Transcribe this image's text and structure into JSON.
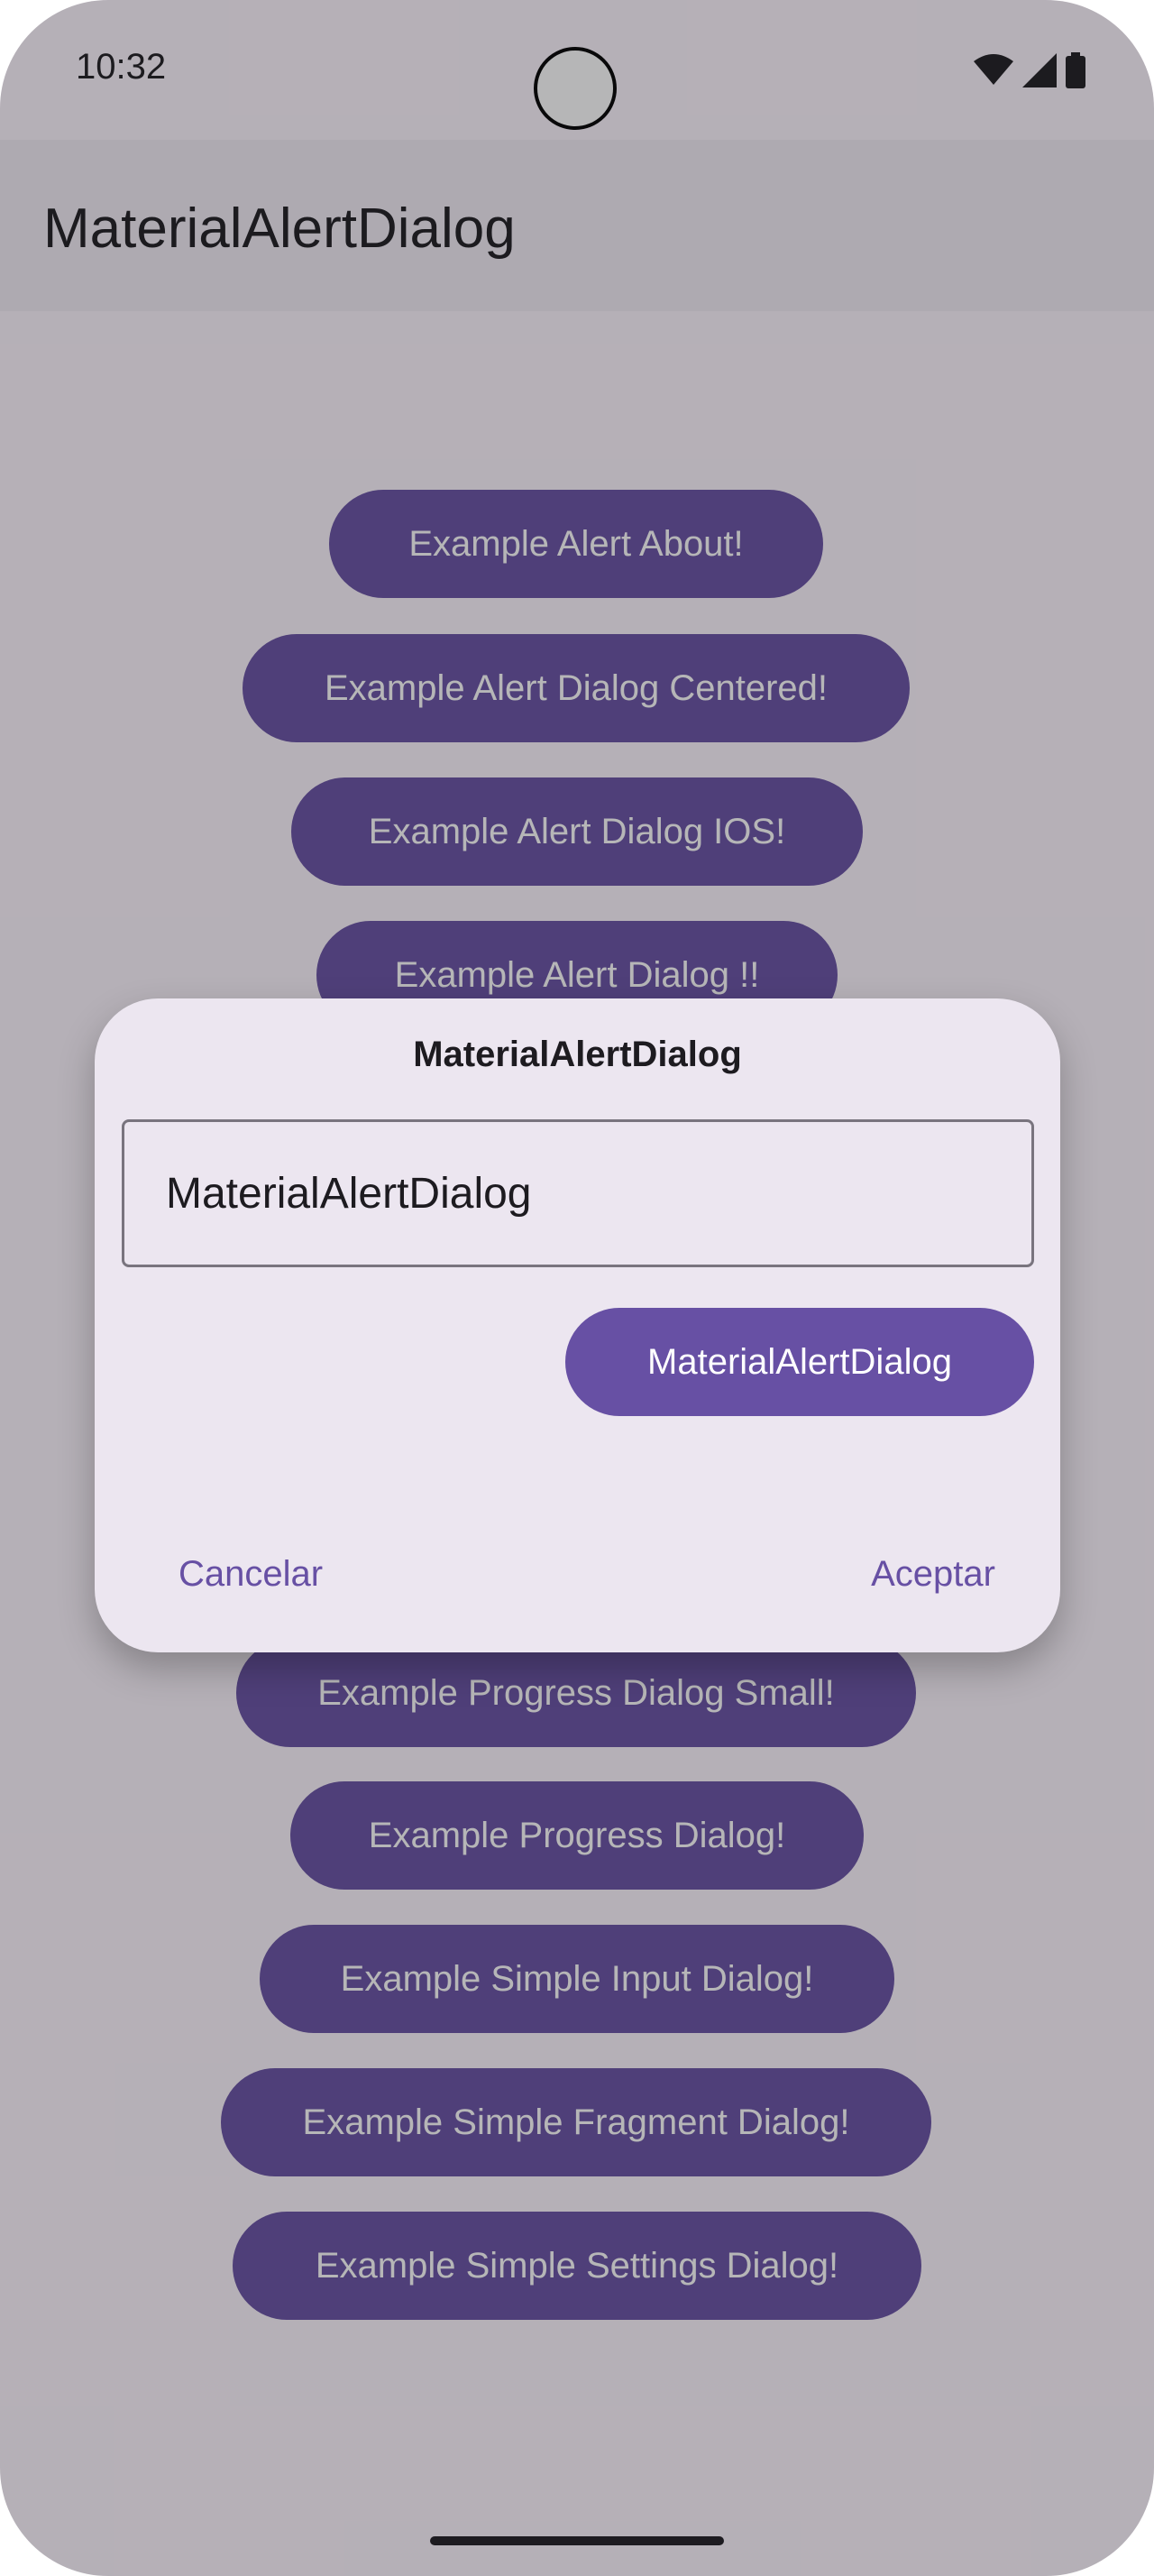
{
  "status_bar": {
    "time": "10:32",
    "icons": [
      "wifi-icon",
      "signal-icon",
      "battery-icon"
    ]
  },
  "app_bar": {
    "title": "MaterialAlertDialog"
  },
  "buttons": [
    "Example Alert About!",
    "Example Alert Dialog Centered!",
    "Example Alert Dialog IOS!",
    "Example Alert Dialog !!",
    "Example Progress Dialog Small!",
    "Example Progress Dialog!",
    "Example Simple Input Dialog!",
    "Example Simple Fragment Dialog!",
    "Example Simple Settings Dialog!"
  ],
  "dialog": {
    "title": "MaterialAlertDialog",
    "input_value": "MaterialAlertDialog",
    "button_label": "MaterialAlertDialog",
    "negative_label": "Cancelar",
    "positive_label": "Aceptar"
  },
  "colors": {
    "primary": "#6750A4",
    "surface": "#FEF7FF",
    "dialog_surface": "#ECE6F0",
    "scrim": "rgba(29,27,32,0.32)"
  }
}
